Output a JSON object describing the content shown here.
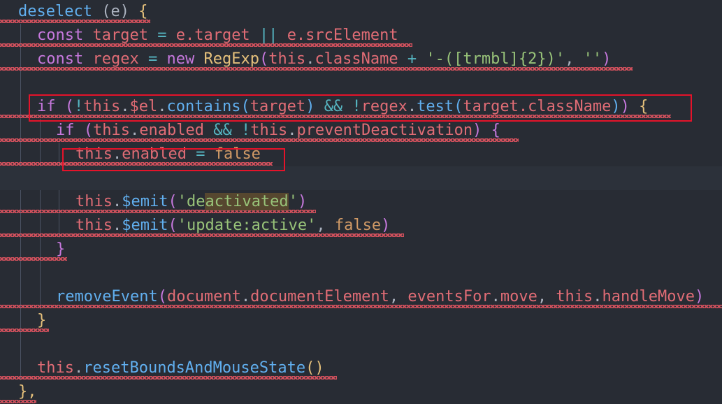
{
  "editor": {
    "tokens": {
      "deselect": "deselect",
      "e": "e",
      "const": "const",
      "target": "target",
      "eq": "=",
      "e_target": "e.target",
      "or": "||",
      "e_src": "e.srcElement",
      "regex": "regex",
      "new": "new",
      "RegExp": "RegExp",
      "this": "this",
      "className": "className",
      "plus": "+",
      "regex_str": "'-([trmbl]{2})'",
      "empty_str": "''",
      "if": "if",
      "not": "!",
      "el": "$el",
      "contains": "contains",
      "and": "&&",
      "test": "test",
      "target_className": "target.className",
      "enabled": "enabled",
      "preventDeactivation": "preventDeactivation",
      "false": "false",
      "emit": "$emit",
      "quote": "'",
      "de": "de",
      "activated": "activated",
      "update_active": "'update:active'",
      "removeEvent": "removeEvent",
      "document": "document",
      "documentElement": "documentElement",
      "eventsFor": "eventsFor",
      "move": "move",
      "handleMove": "handleMove",
      "resetBoundsAndMouseState": "resetBoundsAndMouseState",
      "close_brace_comma": "},"
    }
  }
}
